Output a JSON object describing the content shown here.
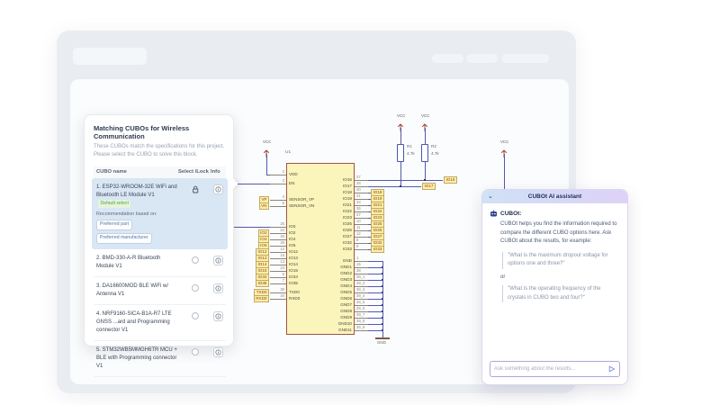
{
  "left_panel": {
    "title": "Matching CUBOs for Wireless Communication",
    "subtitle": "These CUBOs match the specifications for this project. Please select the CUBO to solve this block.",
    "columns": {
      "name": "CUBO name",
      "select_lock": "Select /Lock",
      "info": "Info"
    },
    "rows": [
      {
        "name": "1. ESP32-WROOM-32E WiFi and Bluetooth LE Module V1",
        "badge": "Default select",
        "note": "Recommendation based on:",
        "chips": [
          "Preferred part",
          "Preferred manufacturer"
        ],
        "selected": true,
        "control": "lock"
      },
      {
        "name": "2. BMD-330-A-R Bluetooth Module V1",
        "selected": false,
        "control": "radio"
      },
      {
        "name": "3. DA16600MOD BLE WiFi w/ Antenna V1",
        "selected": false,
        "control": "radio"
      },
      {
        "name": "4. NRF9160-SICA-B1A-R7 LTE GNSS ...ard and Programming connector V1",
        "selected": false,
        "control": "radio"
      },
      {
        "name": "5. STM32WB5MMGH6TR MCU + BLE with Programming connector V1",
        "selected": false,
        "control": "radio"
      }
    ]
  },
  "schematic": {
    "refdes": "U1",
    "power_net": "VCC",
    "ground_net": "GND",
    "left_pins": [
      {
        "num": "2",
        "name": "VDD"
      },
      {
        "num": "3",
        "name": "EN"
      },
      {
        "num": "4",
        "name": "SENSOR_VP",
        "net": "VP"
      },
      {
        "num": "5",
        "name": "SENSOR_VN",
        "net": "VN"
      },
      {
        "num": "25",
        "name": "IO0"
      },
      {
        "num": "24",
        "name": "IO2",
        "net": "IO2"
      },
      {
        "num": "26",
        "name": "IO4",
        "net": "IO4"
      },
      {
        "num": "29",
        "name": "IO5",
        "net": "IO5"
      },
      {
        "num": "14",
        "name": "IO12",
        "net": "IO12"
      },
      {
        "num": "16",
        "name": "IO13",
        "net": "IO13"
      },
      {
        "num": "13",
        "name": "IO14",
        "net": "IO14"
      },
      {
        "num": "23",
        "name": "IO15",
        "net": "IO15"
      },
      {
        "num": "6",
        "name": "IO34",
        "net": "IO34"
      },
      {
        "num": "7",
        "name": "IO35",
        "net": "IO35"
      },
      {
        "num": "35",
        "name": "TXD0",
        "net": "TXD0"
      },
      {
        "num": "34",
        "name": "RXD0",
        "net": "RXD0"
      }
    ],
    "right_pins": [
      {
        "num": "27",
        "name": "IO16",
        "net": "IO16"
      },
      {
        "num": "28",
        "name": "IO17",
        "net": "IO17"
      },
      {
        "num": "30",
        "name": "IO18",
        "net": "IO18"
      },
      {
        "num": "31",
        "name": "IO19",
        "net": "IO19"
      },
      {
        "num": "33",
        "name": "IO21",
        "net": "IO21"
      },
      {
        "num": "36",
        "name": "IO22",
        "net": "IO22"
      },
      {
        "num": "37",
        "name": "IO23",
        "net": "IO23"
      },
      {
        "num": "10",
        "name": "IO25",
        "net": "IO25"
      },
      {
        "num": "11",
        "name": "IO26",
        "net": "IO26"
      },
      {
        "num": "12",
        "name": "IO27",
        "net": "IO27"
      },
      {
        "num": "8",
        "name": "IO32",
        "net": "IO32"
      },
      {
        "num": "9",
        "name": "IO33",
        "net": "IO33"
      }
    ],
    "gnd_pins": [
      {
        "num": "1",
        "name": "GND"
      },
      {
        "num": "15",
        "name": "GND1"
      },
      {
        "num": "38",
        "name": "GND2"
      },
      {
        "num": "39_1",
        "name": "GND3"
      },
      {
        "num": "39_2",
        "name": "GND4"
      },
      {
        "num": "39_3",
        "name": "GND5"
      },
      {
        "num": "39_4",
        "name": "GND6"
      },
      {
        "num": "39_5",
        "name": "GND7"
      },
      {
        "num": "39_6",
        "name": "GND8"
      },
      {
        "num": "39_7",
        "name": "GND9"
      },
      {
        "num": "39_8",
        "name": "GND10"
      },
      {
        "num": "39_9",
        "name": "GND11"
      }
    ],
    "resistors": [
      {
        "ref": "R1",
        "value": "4.7k"
      },
      {
        "ref": "R2",
        "value": "4.7k"
      }
    ]
  },
  "chat": {
    "header": "CUBOt AI assistant",
    "bot_name": "CUBOt:",
    "intro": "CUBOt helps you find the information required to compare the different CUBO options here. Ask CUBOt about the results, for example:",
    "example_1": "\"What is the maximum dropout voltage for options one and three?\"",
    "or_label": "or",
    "example_2": "\"What is the operating frequency of the crystals in CUBO two and four?\"",
    "input_placeholder": "Ask something about the results..."
  },
  "colors": {
    "window_bg": "#e9edf1",
    "canvas_bg": "#fbfcfd",
    "ic_fill": "#fbf5bc",
    "ic_border": "#9c5648",
    "wire": "#5558a8",
    "junction": "#23288c",
    "net_label_fill": "#faf1a3",
    "net_label_border": "#c2a869",
    "net_label_text": "#9a3a28",
    "power_arrow": "#9a3528",
    "selected_row": "#d9e6f4",
    "badge_green": "#58a04a",
    "chat_border": "#b2a3e3"
  }
}
